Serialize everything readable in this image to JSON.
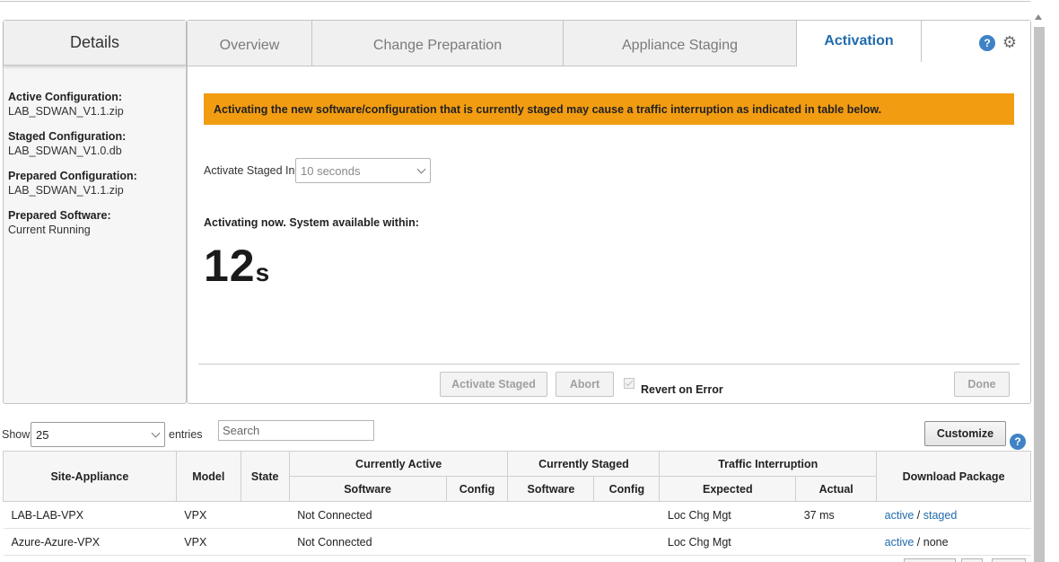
{
  "details": {
    "title": "Details",
    "items": [
      {
        "label": "Active Configuration:",
        "value": "LAB_SDWAN_V1.1.zip"
      },
      {
        "label": "Staged Configuration:",
        "value": "LAB_SDWAN_V1.0.db"
      },
      {
        "label": "Prepared Configuration:",
        "value": "LAB_SDWAN_V1.1.zip"
      },
      {
        "label": "Prepared Software:",
        "value": "Current Running"
      }
    ]
  },
  "tabs": [
    {
      "label": "Overview"
    },
    {
      "label": "Change Preparation"
    },
    {
      "label": "Appliance Staging"
    },
    {
      "label": "Activation"
    }
  ],
  "icons": {
    "help": "?",
    "gear": "⚙"
  },
  "warning_text": "Activating the new software/configuration that is currently staged may cause a traffic interruption as indicated in table below.",
  "activate": {
    "label": "Activate Staged In:",
    "selected": "10 seconds"
  },
  "status": {
    "message": "Activating now. System available within:",
    "countdown_value": "12",
    "countdown_unit": "s"
  },
  "buttons": {
    "activate_staged": "Activate Staged",
    "abort": "Abort",
    "revert_on_error": "Revert on Error",
    "done": "Done",
    "customize": "Customize"
  },
  "table_controls": {
    "show": "Show",
    "entries_value": "25",
    "entries": "entries",
    "search_placeholder": "Search"
  },
  "table": {
    "headers": {
      "site_appliance": "Site-Appliance",
      "model": "Model",
      "state": "State",
      "currently_active": "Currently Active",
      "currently_staged": "Currently Staged",
      "traffic_interruption": "Traffic Interruption",
      "download_package": "Download Package",
      "software": "Software",
      "config": "Config",
      "expected": "Expected",
      "actual": "Actual"
    },
    "rows": [
      {
        "site": "LAB-LAB-VPX",
        "model": "VPX",
        "state": "",
        "active_software": "Not Connected",
        "active_config": "",
        "staged_software": "",
        "staged_config": "",
        "expected": "Loc Chg Mgt",
        "actual": "37 ms",
        "pkg_active": "active",
        "pkg_sep": "/",
        "pkg_second": "staged"
      },
      {
        "site": "Azure-Azure-VPX",
        "model": "VPX",
        "state": "",
        "active_software": "Not Connected",
        "active_config": "",
        "staged_software": "",
        "staged_config": "",
        "expected": "Loc Chg Mgt",
        "actual": "",
        "pkg_active": "active",
        "pkg_sep": "/",
        "pkg_second": "none"
      }
    ]
  }
}
